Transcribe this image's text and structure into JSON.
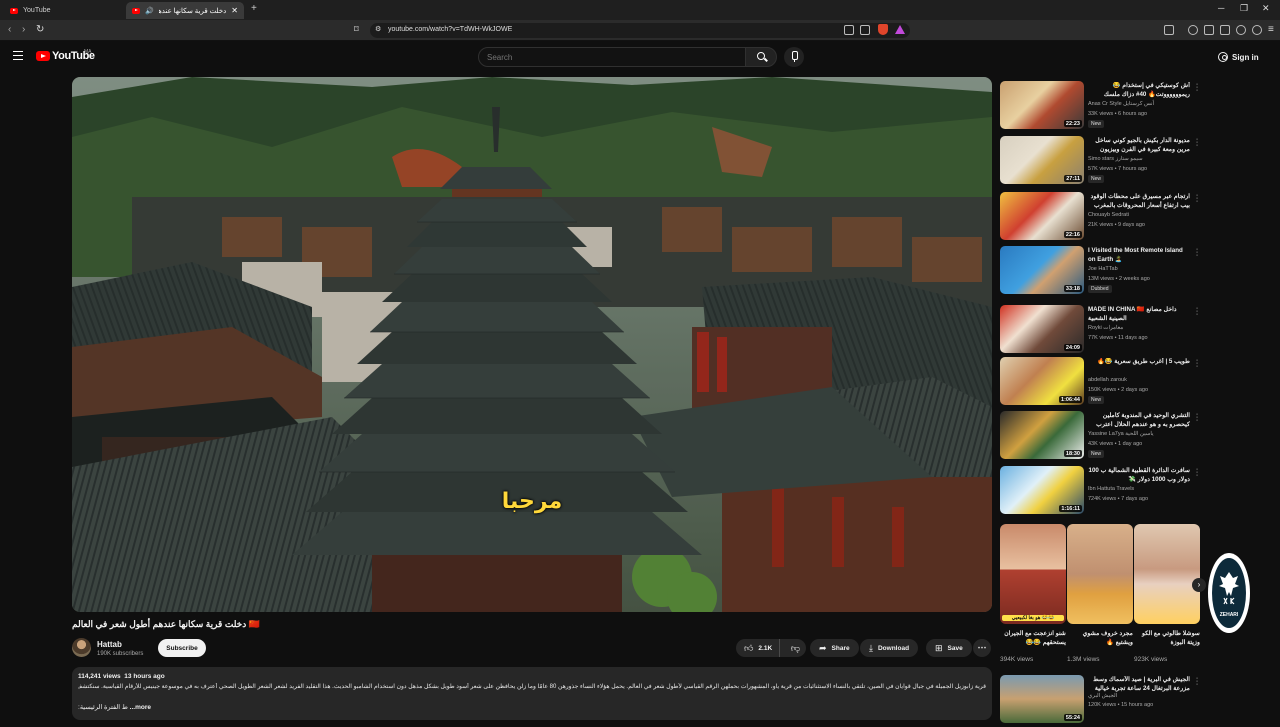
{
  "browser": {
    "tabs": [
      {
        "label": "YouTube"
      },
      {
        "label": "دخلت قرية سكانها عندهم أطول"
      }
    ],
    "url": "youtube.com/watch?v=TdWH-WkJOWE"
  },
  "header": {
    "logo": "YouTube",
    "country_code": "MA",
    "search_placeholder": "Search",
    "signin_label": "Sign in"
  },
  "player": {
    "subtitle": "مرحبا"
  },
  "video": {
    "title": "دخلت قرية سكانها عندهم أطول شعر في العالم 🇨🇳",
    "channel": "Hattab",
    "subscribers": "190K subscribers",
    "subscribe_label": "Subscribe",
    "likes": "2.1K",
    "share_label": "Share",
    "download_label": "Download",
    "save_label": "Save",
    "views": "114,241 views",
    "published": "13 hours ago",
    "description": "قرية زابوزيل الجميلة في جبال قوايان في الصين، تلتقي بالنساء الاستثنائيات من قرية ياو، المشهورات بحملهن الرقم القياسي لأطول شعر في العالم. يحمل هؤلاء النساء جذورهن 80 عامًا وما زلن يحافظن على شعر أسود طويل بشكل مذهل دون استخدام الشامبو الحديث. هذا التقليد الفريد لشعر الشعر الطويل الصحي أعترف به في موسوعة جينيس للأرقام القياسية. سنكتشف هذا الفيديو كيف يحافظن بجمال فريان",
    "more_prefix": ":ط الفترة الرئيسية",
    "more_label": "...more"
  },
  "recommendations": [
    {
      "title": "أش كوستيكي في إستخدام 😂 ريمووووووتت🔥 40# دزاك ملسك",
      "channel": "Anas Cr Style أنس كرستايل",
      "meta": "33K views • 6 hours ago",
      "badge": "New",
      "duration": "22:23"
    },
    {
      "title": "مديونة الدار بكيش بالجيو كوني ساخل مرين ومعة كبيرة في الفرن وبيزيون شهية بالسعيدة",
      "channel": "Simo stars سيمو ستارز",
      "meta": "57K views • 7 hours ago",
      "badge": "New",
      "duration": "27:11"
    },
    {
      "title": "ارتجام عبر مسيرق على محطات الوقود بيب ارتفاع أسعار المحروقات بالمغرب",
      "channel": "Chouayb Sedrati",
      "meta": "21K views • 9 days ago",
      "badge": "",
      "duration": "22:16"
    },
    {
      "title": "I Visited the Most Remote Island on Earth 🏝️",
      "channel": "Joe HaTTab",
      "meta": "13M views • 2 weeks ago",
      "badge": "Dubbed",
      "duration": "33:18"
    },
    {
      "title": "MADE IN CHINA 🇨🇳 داخل مصانع الصينية الشعبية",
      "channel": "Royki مغامرات",
      "meta": "77K views • 11 days ago",
      "badge": "",
      "duration": "24:09"
    },
    {
      "title": "طويب 5 | أغرب طريق سعرية 😂🔥",
      "channel": "abdellah zarouk",
      "meta": "150K views • 2 days ago",
      "badge": "New",
      "duration": "1:06:44"
    },
    {
      "title": "التشري الوحيد في المندوبة كاملين كيحصرو به و هو عندهم الحلال اعترب ضيافيات فردت",
      "channel": "Yassine La7ya ياسين اللحية",
      "meta": "43K views • 1 day ago",
      "badge": "New",
      "duration": "18:30"
    },
    {
      "title": "سافرت الدائرة القطبية الشمالية ب 100 دولار وب 1000 دولار 💸",
      "channel": "Ibn Hattuta Travels",
      "meta": "724K views • 7 days ago",
      "badge": "",
      "duration": "1:16:11"
    }
  ],
  "shorts": [
    {
      "title": "شنو انزعجت مع الجيران يستحقهم 😂😂",
      "views": "394K views",
      "caption": "هو بغا لكبيعيي 😂😂"
    },
    {
      "title": "مجرد خروف مشوي ويشتبع 🔥",
      "views": "1.3M views",
      "caption": ""
    },
    {
      "title": "سوشلا طالوتي مع الكو وزيتة البوزة",
      "views": "923K views",
      "caption": ""
    }
  ],
  "last_rec": {
    "title": "الجيش في البرية | صيد الأسماك وسط مزرعة البرتغال 24 ساعة تجربة خيالية",
    "channel": "الجيش البري",
    "meta": "120K views • 15 hours ago",
    "duration": "55:24"
  },
  "watermark": {
    "text": "ZEHARI"
  }
}
